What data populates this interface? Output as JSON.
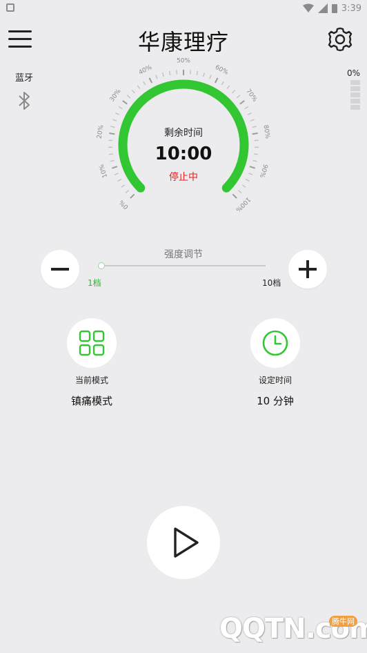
{
  "status_bar": {
    "time": "3:39"
  },
  "app": {
    "title": "华康理疗"
  },
  "bluetooth": {
    "label": "蓝牙"
  },
  "battery": {
    "percent_text": "0%"
  },
  "gauge": {
    "ticks": [
      "0%",
      "10%",
      "20%",
      "30%",
      "40%",
      "50%",
      "60%",
      "70%",
      "80%",
      "90%",
      "100%"
    ],
    "caption": "剩余时间",
    "time": "10:00",
    "status": "停止中",
    "status_color": "#e0201e",
    "arc_color": "#33c633"
  },
  "intensity": {
    "title": "强度调节",
    "min_label": "1档",
    "max_label": "10档",
    "level": 1
  },
  "mode": {
    "label": "当前模式",
    "value": "镇痛模式",
    "icon": "grid-icon"
  },
  "timer": {
    "label": "设定时间",
    "value": "10 分钟",
    "icon": "clock-icon"
  },
  "controls": {
    "play_icon": "play-icon"
  },
  "watermark": {
    "logo": "QQTN.com",
    "tag": "腾牛网"
  },
  "colors": {
    "accent": "#33c633",
    "background": "#ececee"
  }
}
